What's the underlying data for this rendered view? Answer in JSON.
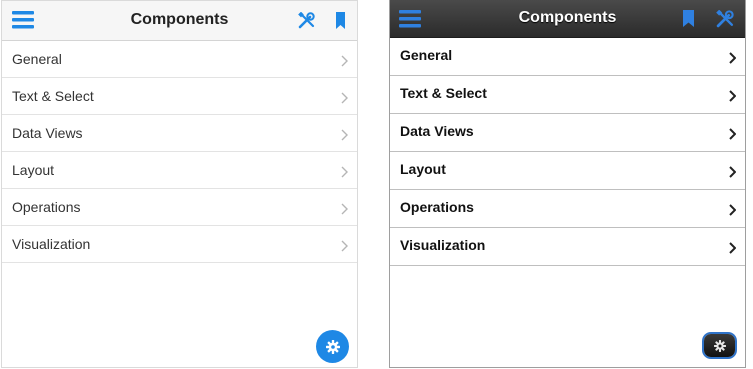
{
  "left_panel": {
    "title": "Components",
    "items": [
      {
        "label": "General"
      },
      {
        "label": "Text & Select"
      },
      {
        "label": "Data Views"
      },
      {
        "label": "Layout"
      },
      {
        "label": "Operations"
      },
      {
        "label": "Visualization"
      }
    ],
    "colors": {
      "accent": "#1e88e5",
      "header_bg": "#f6f6f6",
      "text": "#333333"
    },
    "icons": {
      "menu": "hamburger-menu-icon",
      "tools": "wrench-screwdriver-icon",
      "bookmark": "bookmark-icon",
      "chevron": "chevron-right-icon",
      "fab": "gear-icon"
    }
  },
  "right_panel": {
    "title": "Components",
    "items": [
      {
        "label": "General"
      },
      {
        "label": "Text & Select"
      },
      {
        "label": "Data Views"
      },
      {
        "label": "Layout"
      },
      {
        "label": "Operations"
      },
      {
        "label": "Visualization"
      }
    ],
    "colors": {
      "accent": "#2f80e0",
      "header_bg": "#333333",
      "text": "#111111"
    },
    "icons": {
      "menu": "hamburger-menu-icon",
      "bookmark": "bookmark-icon",
      "tools": "wrench-screwdriver-icon",
      "chevron": "chevron-right-icon",
      "fab": "gear-icon"
    }
  }
}
